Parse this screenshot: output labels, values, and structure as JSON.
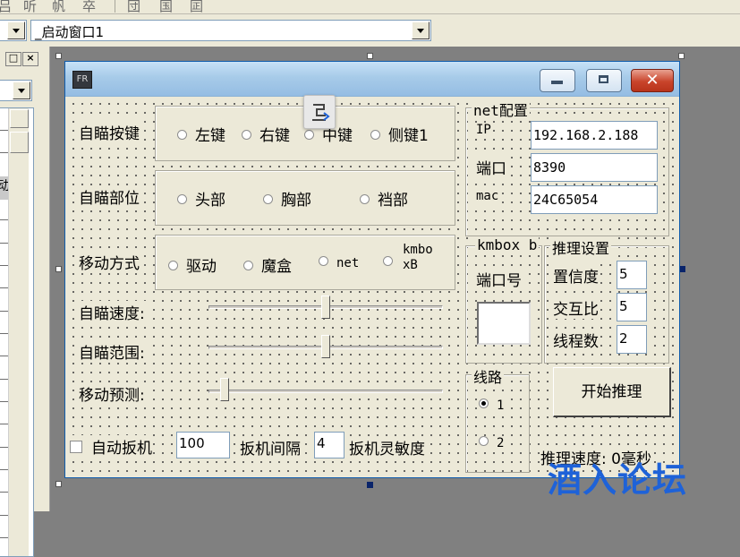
{
  "toolbar": {
    "items": [
      "吕",
      "听",
      "帆",
      "卒",
      "団",
      "国",
      "囸"
    ]
  },
  "combos": {
    "left_value": "",
    "form_selector": "_启动窗口1"
  },
  "left_panel": {
    "pin_label": "□",
    "close_label": "×",
    "selected_text": "动"
  },
  "window": {
    "icon_text": "FR",
    "close_label": "✕"
  },
  "form": {
    "aim_key": {
      "label": "自瞄按键",
      "options": [
        "左键",
        "右键",
        "中键",
        "侧键1"
      ],
      "selected": null
    },
    "aim_part": {
      "label": "自瞄部位",
      "options": [
        "头部",
        "胸部",
        "裆部"
      ],
      "selected": null
    },
    "move_mode": {
      "label": "移动方式",
      "options": [
        "驱动",
        "魔盒",
        "net"
      ],
      "option_kmbox_line1": "kmbo",
      "option_kmbox_line2": "xB",
      "selected": null
    },
    "aim_speed": {
      "label": "自瞄速度:",
      "value_fraction": 0.5
    },
    "aim_range": {
      "label": "自瞄范围:",
      "value_fraction": 0.5
    },
    "move_predict": {
      "label": "移动预测:",
      "value_fraction": 0.05
    },
    "auto_trigger": {
      "label": "自动扳机",
      "checked": false
    },
    "trigger_delay": {
      "value": "100"
    },
    "trigger_interval": {
      "label": "扳机间隔",
      "value": "4"
    },
    "trigger_sensitivity": {
      "label": "扳机灵敏度"
    },
    "net_config": {
      "title": "net配置",
      "ip_label": "IP",
      "ip_value": "192.168.2.188",
      "port_label": "端口",
      "port_value": "8390",
      "mac_label": "mac",
      "mac_value": "24C65054"
    },
    "kmbox_b": {
      "title": "kmbox b",
      "port_label": "端口号",
      "port_value": ""
    },
    "inference": {
      "title": "推理设置",
      "confidence_label": "置信度",
      "confidence_value": "5",
      "iou_label": "交互比",
      "iou_value": "5",
      "threads_label": "线程数",
      "threads_value": "2"
    },
    "route": {
      "title": "线路",
      "options": [
        "1",
        "2"
      ],
      "selected": "1"
    },
    "start_button": "开始推理",
    "speed_text": "推理速度: 0毫秒"
  },
  "watermark": "酒入论坛"
}
